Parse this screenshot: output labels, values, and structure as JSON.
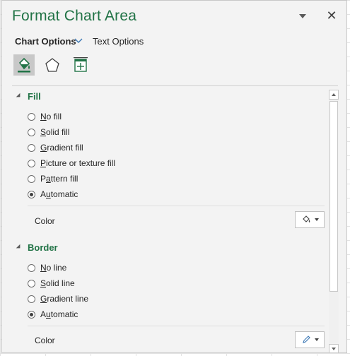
{
  "pane": {
    "title": "Format Chart Area",
    "close_glyph": "✕"
  },
  "tabs": {
    "chart_options": "Chart Options",
    "text_options": "Text Options"
  },
  "icon_tabs": [
    {
      "name": "fill-line-icon",
      "active": true
    },
    {
      "name": "effects-icon",
      "active": false
    },
    {
      "name": "size-properties-icon",
      "active": false
    }
  ],
  "fill": {
    "heading": "Fill",
    "options": [
      {
        "label": "No fill",
        "underline": "N",
        "checked": false
      },
      {
        "label": "Solid fill",
        "underline": "S",
        "checked": false
      },
      {
        "label": "Gradient fill",
        "underline": "G",
        "checked": false
      },
      {
        "label": "Picture or texture fill",
        "underline": "P",
        "checked": false
      },
      {
        "label": "Pattern fill",
        "underline": "a",
        "checked": false
      },
      {
        "label": "Automatic",
        "underline": "u",
        "checked": true
      }
    ],
    "color_label": "Color"
  },
  "border": {
    "heading": "Border",
    "options": [
      {
        "label": "No line",
        "underline": "N",
        "checked": false
      },
      {
        "label": "Solid line",
        "underline": "S",
        "checked": false
      },
      {
        "label": "Gradient line",
        "underline": "G",
        "checked": false
      },
      {
        "label": "Automatic",
        "underline": "u",
        "checked": true
      }
    ],
    "color_label": "Color"
  },
  "colors": {
    "accent": "#217346",
    "panel_bg": "#f3f3f3"
  }
}
